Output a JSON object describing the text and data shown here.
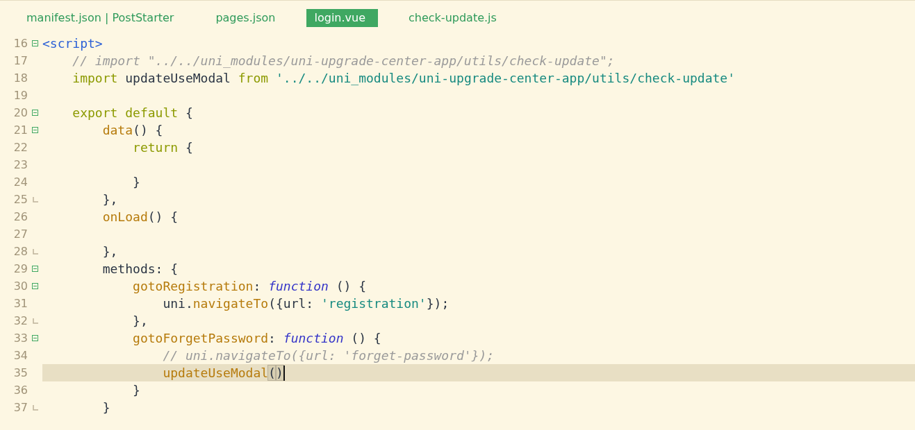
{
  "tabs": [
    {
      "label": "manifest.json | PostStarter",
      "selected": false
    },
    {
      "label": "pages.json",
      "selected": false
    },
    {
      "label": "login.vue",
      "selected": true
    },
    {
      "label": "check-update.js",
      "selected": false
    }
  ],
  "editor": {
    "lines": [
      {
        "number": "16",
        "collapsible": true,
        "block_end": false,
        "current": false,
        "tokens": [
          {
            "kind": "tag",
            "text": "<script>"
          }
        ]
      },
      {
        "number": "17",
        "collapsible": false,
        "block_end": false,
        "current": false,
        "tokens": [
          {
            "kind": "comment",
            "text": "    // import \"../../uni_modules/uni-upgrade-center-app/utils/check-update\";"
          }
        ]
      },
      {
        "number": "18",
        "collapsible": false,
        "block_end": false,
        "current": false,
        "tokens": [
          {
            "kind": "keyword",
            "text": "    import"
          },
          {
            "kind": "plain",
            "text": " updateUseModal "
          },
          {
            "kind": "keyword",
            "text": "from "
          },
          {
            "kind": "string",
            "text": "'../../uni_modules/uni-upgrade-center-app/utils/check-update'"
          }
        ]
      },
      {
        "number": "19",
        "collapsible": false,
        "block_end": false,
        "current": false
      },
      {
        "number": "20",
        "collapsible": true,
        "block_end": false,
        "current": false,
        "tokens": [
          {
            "kind": "keyword",
            "text": "    export default"
          },
          {
            "kind": "plain",
            "text": " {"
          }
        ]
      },
      {
        "number": "21",
        "collapsible": true,
        "block_end": false,
        "current": false,
        "tokens": [
          {
            "kind": "method",
            "text": "        data"
          },
          {
            "kind": "plain",
            "text": "() {"
          }
        ]
      },
      {
        "number": "22",
        "collapsible": false,
        "block_end": false,
        "current": false,
        "tokens": [
          {
            "kind": "keyword",
            "text": "            return"
          },
          {
            "kind": "plain",
            "text": " {"
          }
        ]
      },
      {
        "number": "23",
        "collapsible": false,
        "block_end": false,
        "current": false
      },
      {
        "number": "24",
        "collapsible": false,
        "block_end": false,
        "current": false,
        "tokens": [
          {
            "kind": "plain",
            "text": "            }"
          }
        ]
      },
      {
        "number": "25",
        "collapsible": false,
        "block_end": true,
        "current": false,
        "tokens": [
          {
            "kind": "plain",
            "text": "        },"
          }
        ]
      },
      {
        "number": "26",
        "collapsible": false,
        "block_end": false,
        "current": false,
        "tokens": [
          {
            "kind": "method",
            "text": "        onLoad"
          },
          {
            "kind": "plain",
            "text": "() {"
          }
        ]
      },
      {
        "number": "27",
        "collapsible": false,
        "block_end": false,
        "current": false
      },
      {
        "number": "28",
        "collapsible": false,
        "block_end": true,
        "current": false,
        "tokens": [
          {
            "kind": "plain",
            "text": "        },"
          }
        ]
      },
      {
        "number": "29",
        "collapsible": true,
        "block_end": false,
        "current": false,
        "tokens": [
          {
            "kind": "plain",
            "text": "        methods: {"
          }
        ]
      },
      {
        "number": "30",
        "collapsible": true,
        "block_end": false,
        "current": false,
        "tokens": [
          {
            "kind": "method",
            "text": "            gotoRegistration"
          },
          {
            "kind": "plain",
            "text": ": "
          },
          {
            "kind": "function",
            "text": "function"
          },
          {
            "kind": "plain",
            "text": " () {"
          }
        ]
      },
      {
        "number": "31",
        "collapsible": false,
        "block_end": false,
        "current": false,
        "tokens": [
          {
            "kind": "plain",
            "text": "                uni."
          },
          {
            "kind": "method",
            "text": "navigateTo"
          },
          {
            "kind": "plain",
            "text": "({url: "
          },
          {
            "kind": "string",
            "text": "'registration'"
          },
          {
            "kind": "plain",
            "text": "});"
          }
        ]
      },
      {
        "number": "32",
        "collapsible": false,
        "block_end": true,
        "current": false,
        "tokens": [
          {
            "kind": "plain",
            "text": "            },"
          }
        ]
      },
      {
        "number": "33",
        "collapsible": true,
        "block_end": false,
        "current": false,
        "tokens": [
          {
            "kind": "method",
            "text": "            gotoForgetPassword"
          },
          {
            "kind": "plain",
            "text": ": "
          },
          {
            "kind": "function",
            "text": "function"
          },
          {
            "kind": "plain",
            "text": " () {"
          }
        ]
      },
      {
        "number": "34",
        "collapsible": false,
        "block_end": false,
        "current": false,
        "tokens": [
          {
            "kind": "comment",
            "text": "                // uni.navigateTo({url: 'forget-password'});"
          }
        ]
      },
      {
        "number": "35",
        "collapsible": false,
        "block_end": false,
        "current": true,
        "cursor": true,
        "tokens": [
          {
            "kind": "method",
            "text": "                updateUseModal"
          },
          {
            "kind": "bracket",
            "text": "("
          },
          {
            "kind": "bracket",
            "text": ")"
          }
        ]
      },
      {
        "number": "36",
        "collapsible": false,
        "block_end": false,
        "current": false,
        "tokens": [
          {
            "kind": "plain",
            "text": "            }"
          }
        ]
      },
      {
        "number": "37",
        "collapsible": false,
        "block_end": true,
        "current": false,
        "tokens": [
          {
            "kind": "plain",
            "text": "        }"
          }
        ]
      }
    ]
  }
}
